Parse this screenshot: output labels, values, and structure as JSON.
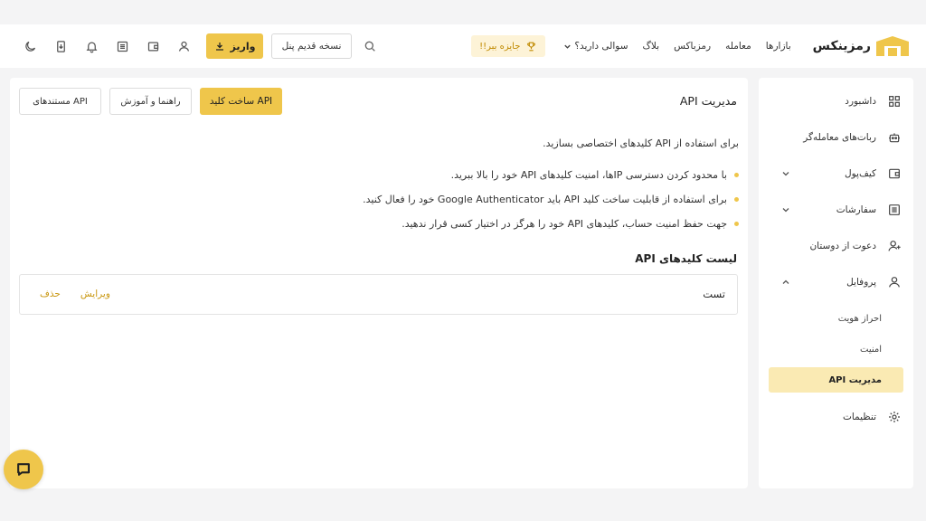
{
  "header": {
    "logo_text": "رمزینکس",
    "nav": [
      "بازارها",
      "معامله",
      "رمزباکس",
      "بلاگ",
      "سوالی دارید؟"
    ],
    "prize_label": "جایزه ببر!!",
    "old_panel_label": "نسخه قدیم پنل",
    "deposit_label": "واریز",
    "icons": [
      "moon-icon",
      "deposit-doc-icon",
      "bell-icon",
      "orders-icon",
      "wallet-icon",
      "user-icon"
    ]
  },
  "sidebar": {
    "items": [
      {
        "label": "داشبورد",
        "icon": "dashboard-icon"
      },
      {
        "label": "ربات‌های معامله‌گر",
        "icon": "robot-icon"
      },
      {
        "label": "کیف‌پول",
        "icon": "wallet-icon"
      },
      {
        "label": "سفارشات",
        "icon": "orders-icon"
      },
      {
        "label": "دعوت از دوستان",
        "icon": "invite-icon"
      },
      {
        "label": "پروفایل",
        "icon": "profile-icon"
      }
    ],
    "sub_items": [
      "احراز هویت",
      "امنیت",
      "مدیریت API"
    ],
    "settings_label": "تنظیمات"
  },
  "main": {
    "title": "مدیریت API",
    "buttons": {
      "create": "ساخت کلید API",
      "guide": "راهنما و آموزش",
      "docs": "مستندهای API"
    },
    "intro": "برای استفاده از API کلیدهای اختصاصی بسازید.",
    "bullets": [
      "با محدود کردن دسترسی IPها، امنیت کلیدهای API خود را بالا ببرید.",
      "برای استفاده از قابلیت ساخت کلید API باید Google Authenticator خود را فعال کنید.",
      "جهت حفظ امنیت حساب، کلیدهای API خود را هرگز در اختیار کسی قرار ندهید."
    ],
    "list_title": "لیست کلیدهای API",
    "keys": [
      {
        "name": "تست",
        "edit": "ویرایش",
        "delete": "حذف"
      }
    ]
  },
  "colors": {
    "accent": "#efc64b",
    "accent_light": "#faeab3",
    "link": "#c9970f"
  }
}
